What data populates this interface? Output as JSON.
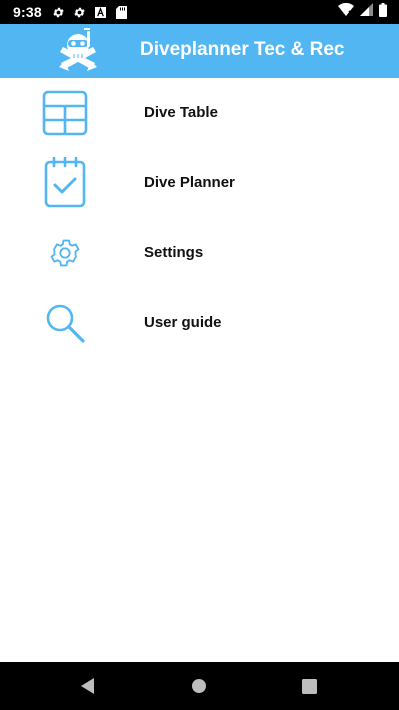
{
  "status_bar": {
    "time": "9:38",
    "left_icons": [
      "gear-icon",
      "gear-icon",
      "font-a-icon",
      "sd-card-icon"
    ],
    "right_icons": [
      "wifi-icon",
      "signal-icon",
      "battery-icon"
    ]
  },
  "app_bar": {
    "title": "Diveplanner Tec & Rec",
    "logo_icon": "diver-skull-logo-icon",
    "background_color": "#52b6f2"
  },
  "menu": {
    "items": [
      {
        "label": "Dive Table",
        "icon": "table-grid-icon"
      },
      {
        "label": "Dive Planner",
        "icon": "calendar-check-icon"
      },
      {
        "label": "Settings",
        "icon": "gear-icon"
      },
      {
        "label": "User guide",
        "icon": "magnifier-icon"
      }
    ],
    "icon_color": "#52b6f2"
  },
  "nav_bar": {
    "buttons": [
      "back-icon",
      "home-icon",
      "recents-icon"
    ]
  }
}
